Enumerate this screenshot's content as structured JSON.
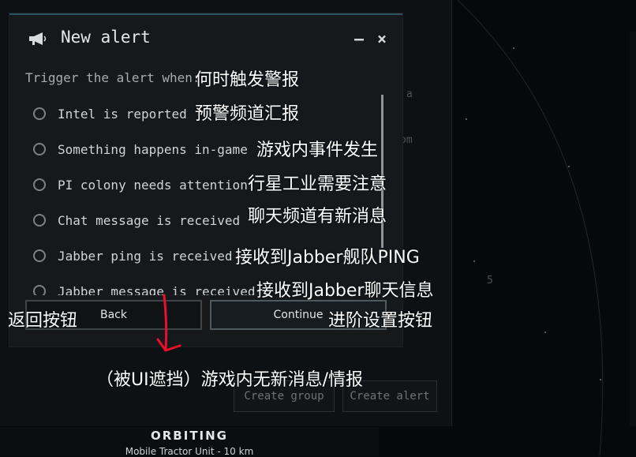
{
  "dialog": {
    "title": "New alert",
    "minimize_label": "—",
    "close_label": "×",
    "subtitle": "Trigger the alert when:",
    "options": [
      {
        "label": "Intel is reported"
      },
      {
        "label": "Something happens in-game"
      },
      {
        "label": "PI colony needs attention"
      },
      {
        "label": "Chat message is received"
      },
      {
        "label": "Jabber ping is received"
      },
      {
        "label": "Jabber message is received"
      }
    ],
    "back_label": "Back",
    "continue_label": "Continue"
  },
  "background": {
    "create_group_label": "Create group",
    "create_alert_label": "Create alert",
    "ghost_a": "a",
    "ghost_om": "om",
    "ghost_5": "5",
    "orbit_title": "ORBITING",
    "orbit_sub": "Mobile Tractor Unit - 10 km"
  },
  "annotations": {
    "subtitle": "何时触发警报",
    "opt0": "预警频道汇报",
    "opt1": "游戏内事件发生",
    "opt2": "行星工业需要注意",
    "opt3": "聊天频道有新消息",
    "opt4": "接收到Jabber舰队PING",
    "opt5": "接收到Jabber聊天信息",
    "back": "返回按钮",
    "continue": "进阶设置按钮",
    "hidden": "（被UI遮挡）游戏内无新消息/情报"
  },
  "colors": {
    "annotation_arrow": "#e8102a",
    "dialog_accent": "#2f5060"
  }
}
